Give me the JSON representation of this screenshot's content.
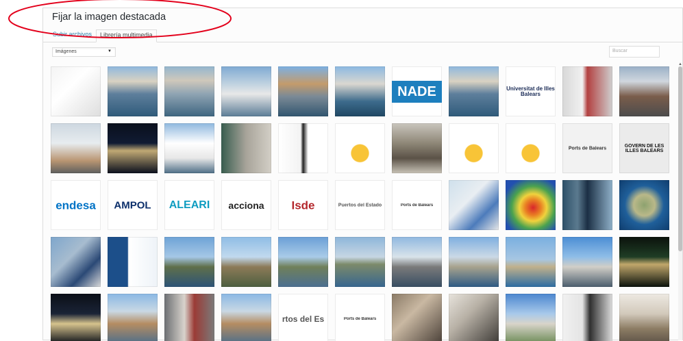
{
  "modal": {
    "title": "Fijar la imagen destacada",
    "tabs": [
      {
        "label": "Subir archivos",
        "active": false
      },
      {
        "label": "Librería multimedia",
        "active": true
      }
    ]
  },
  "filter": {
    "selected": "Imágenes"
  },
  "search": {
    "placeholder": "Buscar"
  },
  "colors": {
    "accent": "#2e7fa9",
    "annotation": "#e3001b"
  },
  "media": [
    {
      "type": "photo",
      "name": "iphone",
      "bg": "linear-gradient(135deg,#f4f4f4 0%,#ffffff 40%,#dedede 100%)"
    },
    {
      "type": "photo",
      "name": "harbor-boats",
      "bg": "linear-gradient(180deg,#8fb8de 0%,#d9d2c2 30%,#5e7f9c 55%,#2f5a7a 100%)"
    },
    {
      "type": "photo",
      "name": "marina-boats",
      "bg": "linear-gradient(180deg,#94b6cf 0%,#cfc8bb 28%,#8fa4b3 55%,#3e6580 100%)"
    },
    {
      "type": "photo",
      "name": "marina-masts",
      "bg": "linear-gradient(180deg,#7faad3 0%,#c0d2e0 35%,#e8e8e8 55%,#5b7c96 100%)"
    },
    {
      "type": "photo",
      "name": "palma-marina",
      "bg": "linear-gradient(180deg,#7cb0e3 0%,#c49b6b 35%,#7b8a96 60%,#31556f 100%)"
    },
    {
      "type": "photo",
      "name": "yacht-dock",
      "bg": "linear-gradient(180deg,#8cb9e2 0%,#dad7d0 35%,#3d6b8c 70%,#1f4763 100%)"
    },
    {
      "type": "logo",
      "name": "anade-logo",
      "text": "NADE",
      "bg": "#ffffff",
      "color": "#ffffff",
      "chipBg": "#1d7fbe",
      "size": 20
    },
    {
      "type": "photo",
      "name": "harbor-boats-2",
      "bg": "linear-gradient(180deg,#8fb8de 0%,#d9d2c2 30%,#5e7f9c 55%,#2f5a7a 100%)"
    },
    {
      "type": "logo",
      "name": "uib-logo",
      "text": "Universitat de Illes Balears",
      "bg": "#ffffff",
      "color": "#1a2b56",
      "size": 8
    },
    {
      "type": "photo",
      "name": "cruise-ship-pier",
      "bg": "linear-gradient(90deg,#d8d8d8 0%,#f1f1f1 40%,#b34141 50%,#cfcfcf 100%)"
    },
    {
      "type": "photo",
      "name": "travellers-terminal",
      "bg": "linear-gradient(180deg,#9ab0c7 0%,#d0d7de 30%,#7a5d4b 60%,#4c4c4c 100%)"
    },
    {
      "type": "photo",
      "name": "ship-hull",
      "bg": "linear-gradient(180deg,#cdd7e0 0%,#e7ecef 40%,#b99572 75%,#5e5e5e 100%)"
    },
    {
      "type": "photo",
      "name": "cruise-night",
      "bg": "linear-gradient(180deg,#0a0f1c 0%,#101b33 40%,#c0a874 55%,#0a0f1c 100%)"
    },
    {
      "type": "photo",
      "name": "cruise-bow",
      "bg": "linear-gradient(180deg,#8fb8de 0%,#ffffff 40%,#e7e7e7 70%,#4d6e86 100%)"
    },
    {
      "type": "photo",
      "name": "people-waiting",
      "bg": "linear-gradient(90deg,#385d4f 0%,#a8a49a 50%,#d3cfc6 100%)"
    },
    {
      "type": "photo",
      "name": "qr-phone-diagram",
      "bg": "linear-gradient(90deg,#ffffff 0%,#f3f3f3 45%,#222222 50%,#ffffff 60%)"
    },
    {
      "type": "photo",
      "name": "plataforma-innovacion",
      "bg": "radial-gradient(circle at 50% 60%,#f8c437 0%,#f8c437 22%,#ffffff 24%)"
    },
    {
      "type": "photo",
      "name": "boat-interior",
      "bg": "linear-gradient(180deg,#c9c5bd 0%,#8e8777 40%,#5b5247 70%,#c7c2b6 100%)"
    },
    {
      "type": "photo",
      "name": "plataforma-innovacion-2",
      "bg": "radial-gradient(circle at 50% 60%,#f8c437 0%,#f8c437 22%,#ffffff 24%)"
    },
    {
      "type": "photo",
      "name": "plataforma-innovacion-3",
      "bg": "radial-gradient(circle at 50% 60%,#f8c437 0%,#f8c437 22%,#ffffff 24%)"
    },
    {
      "type": "logo",
      "name": "ports-de-balears-logo",
      "text": "Ports de Balears",
      "bg": "#f2f2f2",
      "color": "#333333",
      "size": 7
    },
    {
      "type": "logo",
      "name": "govern-illes-balears-logo",
      "text": "GOVERN DE LES ILLES BALEARS",
      "bg": "#ebebeb",
      "color": "#111111",
      "size": 7
    },
    {
      "type": "logo",
      "name": "endesa-logo",
      "text": "endesa",
      "bg": "#ffffff",
      "color": "#0073c6",
      "size": 17
    },
    {
      "type": "logo",
      "name": "ampol-logo",
      "text": "AMPOL",
      "bg": "#ffffff",
      "color": "#0c2f6b",
      "size": 15
    },
    {
      "type": "logo",
      "name": "baleari-logo",
      "text": "ALEARI",
      "bg": "#ffffff",
      "color": "#0e9cc0",
      "size": 16
    },
    {
      "type": "logo",
      "name": "acciona-logo",
      "text": "acciona",
      "bg": "#ffffff",
      "color": "#222222",
      "size": 14
    },
    {
      "type": "logo",
      "name": "isdefe-logo",
      "text": "Isde",
      "bg": "#ffffff",
      "color": "#b3262b",
      "size": 17
    },
    {
      "type": "logo",
      "name": "puertos-del-estado-logo",
      "text": "Puertos del Estado",
      "bg": "#ffffff",
      "color": "#555555",
      "size": 7
    },
    {
      "type": "logo",
      "name": "ports-de-balears-logo-2",
      "text": "Ports de Balears",
      "bg": "#ffffff",
      "color": "#333333",
      "size": 6
    },
    {
      "type": "photo",
      "name": "map-screenshot",
      "bg": "linear-gradient(135deg,#cfe0ec 0%,#e9eef2 40%,#4c7bbb 70%,#e7e7e7 100%)"
    },
    {
      "type": "photo",
      "name": "wave-heatmap",
      "bg": "radial-gradient(circle at 55% 55%,#d8262b 0%,#e97f23 20%,#f0d23d 35%,#4aa24f 55%,#2250b0 80%)"
    },
    {
      "type": "photo",
      "name": "app-screens",
      "bg": "linear-gradient(90deg,#2d4f68 0%,#5b7a8f 30%,#1b2f44 50%,#8fb0c8 100%)"
    },
    {
      "type": "photo",
      "name": "mallorca-map",
      "bg": "radial-gradient(circle at 50% 50%,#8da26f 0%,#b9b889 30%,#1f5f9a 55%,#0f3d6e 100%)"
    },
    {
      "type": "photo",
      "name": "coast-chart",
      "bg": "linear-gradient(135deg,#7ea6cc 0%,#a7bccf 40%,#2b4976 70%,#d9d9d9 100%)"
    },
    {
      "type": "photo",
      "name": "data-table",
      "bg": "linear-gradient(90deg,#1c4f8a 0%,#1c4f8a 40%,#ffffff 42%,#eef3f8 100%)"
    },
    {
      "type": "photo",
      "name": "coast-panorama",
      "bg": "linear-gradient(180deg,#6ea3d6 0%,#a5c7e6 40%,#5f6f4a 60%,#2d5477 100%)"
    },
    {
      "type": "photo",
      "name": "rocky-shore",
      "bg": "linear-gradient(180deg,#8fbde5 0%,#c1d9ee 40%,#8c7a58 60%,#4d5f3f 100%)"
    },
    {
      "type": "photo",
      "name": "coastal-road",
      "bg": "linear-gradient(180deg,#6b9fd6 0%,#a9cbe8 40%,#70805a 60%,#4b6f91 100%)"
    },
    {
      "type": "photo",
      "name": "sea-view",
      "bg": "linear-gradient(180deg,#8eb6da 0%,#c6d6e3 40%,#7c8a6a 55%,#37668f 100%)"
    },
    {
      "type": "photo",
      "name": "lighthouse-tower",
      "bg": "linear-gradient(180deg,#90b8e0 0%,#d9e3ea 40%,#7a7a7a 60%,#384e63 100%)"
    },
    {
      "type": "photo",
      "name": "lighthouse-coast",
      "bg": "linear-gradient(180deg,#7fafe0 0%,#cbd9e6 40%,#a7a28d 60%,#2e5a84 100%)"
    },
    {
      "type": "photo",
      "name": "cliff-coast",
      "bg": "linear-gradient(180deg,#7aafe0 0%,#a6c6e2 45%,#c0b08b 60%,#2c6ca2 100%)"
    },
    {
      "type": "photo",
      "name": "terminal-building",
      "bg": "linear-gradient(180deg,#4c8ed4 0%,#8fbde7 40%,#d1cec7 60%,#4b5d6d 100%)"
    },
    {
      "type": "photo",
      "name": "terminal-night",
      "bg": "linear-gradient(180deg,#0b120c 0%,#1f3d25 40%,#c1a76b 55%,#0b120c 100%)"
    },
    {
      "type": "photo",
      "name": "ferry-night",
      "bg": "linear-gradient(180deg,#0b0f17 0%,#1a2336 40%,#d6c38d 60%,#0b0f17 100%)"
    },
    {
      "type": "photo",
      "name": "port-town",
      "bg": "linear-gradient(180deg,#8ab8e4 0%,#c9d8e4 35%,#b58d62 60%,#4e6e8a 100%)"
    },
    {
      "type": "photo",
      "name": "passengers-walkway",
      "bg": "linear-gradient(90deg,#6c6f73 0%,#d8d3cc 40%,#9b3b36 60%,#7a7a7a 100%)"
    },
    {
      "type": "photo",
      "name": "port-town-2",
      "bg": "linear-gradient(180deg,#8ab8e4 0%,#c9d8e4 35%,#b58d62 60%,#4e6e8a 100%)"
    },
    {
      "type": "logo",
      "name": "puertos-del-estado-logo-2",
      "text": "rtos del Es",
      "bg": "#ffffff",
      "color": "#555555",
      "size": 12
    },
    {
      "type": "logo",
      "name": "ports-de-balears-logo-3",
      "text": "Ports de Balears",
      "bg": "#ffffff",
      "color": "#333333",
      "size": 6
    },
    {
      "type": "photo",
      "name": "office-meeting",
      "bg": "linear-gradient(135deg,#8a7a66 0%,#c9b8a2 40%,#4a4038 100%)"
    },
    {
      "type": "photo",
      "name": "laptop-work",
      "bg": "linear-gradient(135deg,#e7e3dc 0%,#b8b1a6 40%,#3d3a36 100%)"
    },
    {
      "type": "photo",
      "name": "building-exterior",
      "bg": "linear-gradient(180deg,#4b86cf 0%,#a8c9ea 40%,#d8d4ca 60%,#6b8a55 100%)"
    },
    {
      "type": "photo",
      "name": "office-person",
      "bg": "linear-gradient(90deg,#f1f1f1 0%,#e4e4e4 40%,#2f2f2f 55%,#dcdcdc 100%)"
    },
    {
      "type": "photo",
      "name": "lobby-interior",
      "bg": "linear-gradient(180deg,#ede9e2 0%,#d2c9bb 40%,#8c7c64 70%,#5d5347 100%)"
    }
  ]
}
